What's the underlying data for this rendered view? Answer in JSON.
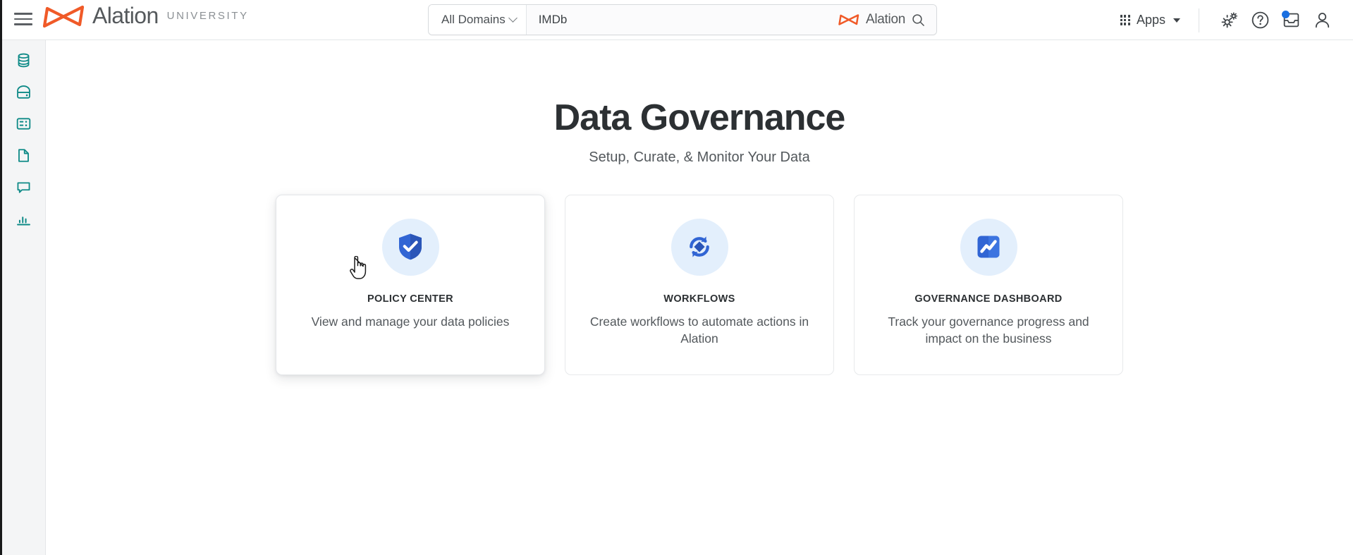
{
  "header": {
    "menu_icon": "hamburger-menu-icon",
    "brand": {
      "logo_icon": "alation-bowtie-logo",
      "name": "Alation",
      "suffix": "UNIVERSITY"
    },
    "search": {
      "domain_filter_label": "All Domains",
      "domain_chevron_icon": "chevron-down-icon",
      "query_value": "IMDb",
      "placeholder": "Search",
      "brand_label": "Alation",
      "brand_logo_icon": "alation-bowtie-logo",
      "search_icon": "search-icon"
    },
    "apps": {
      "label": "Apps",
      "grid_icon": "apps-grid-icon",
      "caret_icon": "caret-down-icon"
    },
    "icons": [
      {
        "name": "settings-gears-icon",
        "label": "Settings"
      },
      {
        "name": "help-question-icon",
        "label": "Help"
      },
      {
        "name": "inbox-icon",
        "label": "Inbox",
        "has_notification": true
      },
      {
        "name": "user-account-icon",
        "label": "Account"
      }
    ]
  },
  "sidebar": {
    "items": [
      {
        "name": "sidebar-item-data-sources",
        "icon": "database-icon",
        "label": "Data Sources"
      },
      {
        "name": "sidebar-item-bi-servers",
        "icon": "server-drive-icon",
        "label": "BI Servers"
      },
      {
        "name": "sidebar-item-catalog-sets",
        "icon": "table-grid-icon",
        "label": "Catalog Sets"
      },
      {
        "name": "sidebar-item-articles",
        "icon": "document-icon",
        "label": "Articles"
      },
      {
        "name": "sidebar-item-conversations",
        "icon": "chat-bubble-icon",
        "label": "Conversations"
      },
      {
        "name": "sidebar-item-analytics",
        "icon": "bar-chart-icon",
        "label": "Analytics"
      }
    ],
    "accent_color": "#0e8a87"
  },
  "main": {
    "title": "Data Governance",
    "subtitle": "Setup, Curate, & Monitor Your Data",
    "cards": [
      {
        "id": "policy-center",
        "icon": "shield-check-icon",
        "title": "POLICY CENTER",
        "description": "View and manage your data policies",
        "hovered": true
      },
      {
        "id": "workflows",
        "icon": "sync-arrows-icon",
        "title": "WORKFLOWS",
        "description": "Create workflows to automate actions in Alation",
        "hovered": false
      },
      {
        "id": "governance-dashboard",
        "icon": "trend-chart-icon",
        "title": "GOVERNANCE DASHBOARD",
        "description": "Track your governance progress and impact on the business",
        "hovered": false
      }
    ]
  },
  "colors": {
    "brand_orange": "#f05a28",
    "accent_blue": "#3165d4",
    "icon_bg_blue": "#e3effc",
    "sidebar_teal": "#0e8a87",
    "text_dark": "#2c3033",
    "text_muted": "#53585c"
  },
  "cursor": {
    "type": "pointer-hand-cursor"
  }
}
